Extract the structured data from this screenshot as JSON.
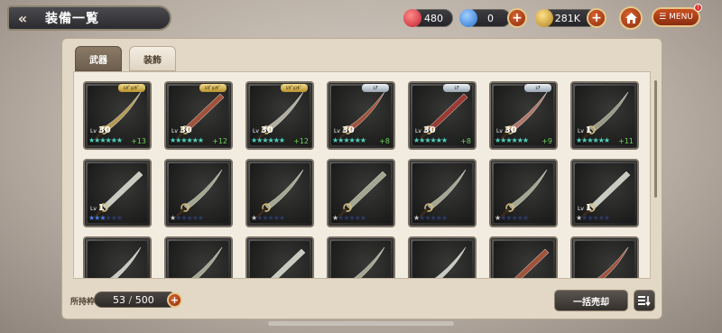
{
  "header": {
    "title": "装備一覧",
    "back_icon": "double-chevron-left-icon"
  },
  "resources": [
    {
      "name": "red-gem",
      "value": "480",
      "color": "#e0384a"
    },
    {
      "name": "blue-gem",
      "value": "0",
      "color": "#3a8ee8"
    },
    {
      "name": "gold-coin",
      "value": "281K",
      "color": "#e8b84a"
    }
  ],
  "menu": {
    "label": "MENU",
    "badge": "!",
    "home_icon": "home-icon"
  },
  "tabs": [
    {
      "label": "武器",
      "active": true
    },
    {
      "label": "装飾",
      "active": false
    }
  ],
  "items": [
    {
      "rarity": "gold",
      "rarity_label": "ﾚｼﾞｪﾝﾄﾞ",
      "level": "30",
      "stars_filled": 6,
      "star_color": "#4fd6c0",
      "plus": "+13",
      "blade": "#b49a55"
    },
    {
      "rarity": "gold",
      "rarity_label": "ﾚｼﾞｪﾝﾄﾞ",
      "level": "30",
      "stars_filled": 6,
      "star_color": "#4fd6c0",
      "plus": "+12",
      "blade": "#a0523a"
    },
    {
      "rarity": "gold",
      "rarity_label": "ﾚｼﾞｪﾝﾄﾞ",
      "level": "30",
      "stars_filled": 6,
      "star_color": "#4fd6c0",
      "plus": "+12",
      "blade": "#b0ae9e"
    },
    {
      "rarity": "silver",
      "rarity_label": "ﾚｱ",
      "level": "30",
      "stars_filled": 6,
      "star_color": "#4fd6c0",
      "plus": "+8",
      "blade": "#a0523a"
    },
    {
      "rarity": "silver",
      "rarity_label": "ﾚｱ",
      "level": "30",
      "stars_filled": 6,
      "star_color": "#4fd6c0",
      "plus": "+8",
      "blade": "#9a3a32"
    },
    {
      "rarity": "silver",
      "rarity_label": "ﾚｱ",
      "level": "30",
      "stars_filled": 6,
      "star_color": "#4fd6c0",
      "plus": "+9",
      "blade": "#b0786a"
    },
    {
      "rarity": "",
      "rarity_label": "",
      "level": "1",
      "stars_filled": 6,
      "star_color": "#4fd6c0",
      "plus": "+11",
      "blade": "#9a9a84"
    },
    {
      "rarity": "",
      "rarity_label": "",
      "level": "1",
      "stars_filled": 3,
      "star_color": "#4a7ee0",
      "plus": "",
      "blade": "#c8cbc0"
    },
    {
      "rarity": "",
      "rarity_label": "",
      "level": "",
      "stars_filled": 1,
      "star_color": "#c8c8c8",
      "plus": "",
      "blade": "#a4a690"
    },
    {
      "rarity": "",
      "rarity_label": "",
      "level": "",
      "stars_filled": 1,
      "star_color": "#c8c8c8",
      "plus": "",
      "blade": "#a4a690"
    },
    {
      "rarity": "",
      "rarity_label": "",
      "level": "",
      "stars_filled": 1,
      "star_color": "#c8c8c8",
      "plus": "",
      "blade": "#a4a690"
    },
    {
      "rarity": "",
      "rarity_label": "",
      "level": "",
      "stars_filled": 1,
      "star_color": "#c8c8c8",
      "plus": "",
      "blade": "#a4a690"
    },
    {
      "rarity": "",
      "rarity_label": "",
      "level": "",
      "stars_filled": 1,
      "star_color": "#c8c8c8",
      "plus": "",
      "blade": "#a4a690"
    },
    {
      "rarity": "",
      "rarity_label": "",
      "level": "1",
      "stars_filled": 1,
      "star_color": "#c8c8c8",
      "plus": "",
      "blade": "#c8cbc0"
    },
    {
      "rarity": "",
      "rarity_label": "",
      "level": "",
      "stars_filled": 0,
      "star_color": "#c8c8c8",
      "plus": "",
      "blade": "#c8cbc0"
    },
    {
      "rarity": "",
      "rarity_label": "",
      "level": "",
      "stars_filled": 0,
      "star_color": "#c8c8c8",
      "plus": "",
      "blade": "#a4a690"
    },
    {
      "rarity": "",
      "rarity_label": "",
      "level": "",
      "stars_filled": 0,
      "star_color": "#c8c8c8",
      "plus": "",
      "blade": "#c8cbc0"
    },
    {
      "rarity": "",
      "rarity_label": "",
      "level": "",
      "stars_filled": 0,
      "star_color": "#c8c8c8",
      "plus": "",
      "blade": "#a4a690"
    },
    {
      "rarity": "",
      "rarity_label": "",
      "level": "",
      "stars_filled": 0,
      "star_color": "#c8c8c8",
      "plus": "",
      "blade": "#c8cbc0"
    },
    {
      "rarity": "",
      "rarity_label": "",
      "level": "",
      "stars_filled": 0,
      "star_color": "#c8c8c8",
      "plus": "",
      "blade": "#a0523a"
    },
    {
      "rarity": "",
      "rarity_label": "",
      "level": "",
      "stars_filled": 0,
      "star_color": "#c8c8c8",
      "plus": "",
      "blade": "#a0523a"
    }
  ],
  "footer": {
    "capacity_label": "所持枠",
    "capacity_current": "53",
    "capacity_sep": " / ",
    "capacity_max": "500",
    "sell_label": "一括売却",
    "sort_icon": "sort-icon"
  }
}
